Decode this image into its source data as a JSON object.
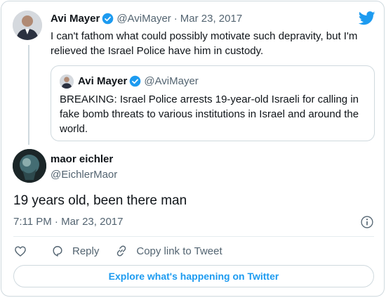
{
  "parent_tweet": {
    "author_name": "Avi Mayer",
    "handle": "@AviMayer",
    "separator": "·",
    "date": "Mar 23, 2017",
    "text": "I can't fathom what could possibly motivate such depravity, but I'm relieved the Israel Police have him in custody."
  },
  "quoted_tweet": {
    "author_name": "Avi Mayer",
    "handle": "@AviMayer",
    "text": "BREAKING: Israel Police arrests 19-year-old Israeli for calling in fake bomb threats to various institutions in Israel and around the world."
  },
  "reply_tweet": {
    "author_name": "maor eichler",
    "handle": "@EichlerMaor",
    "text": "19 years old, been there man",
    "timestamp": "7:11 PM · Mar 23, 2017"
  },
  "actions": {
    "like_icon": "heart-icon",
    "reply_label": "Reply",
    "copy_link_label": "Copy link to Tweet"
  },
  "explore_button_label": "Explore what's happening on Twitter",
  "colors": {
    "accent": "#1d9bf0",
    "text": "#0f1419",
    "muted": "#536471",
    "border": "#cfd9de"
  }
}
